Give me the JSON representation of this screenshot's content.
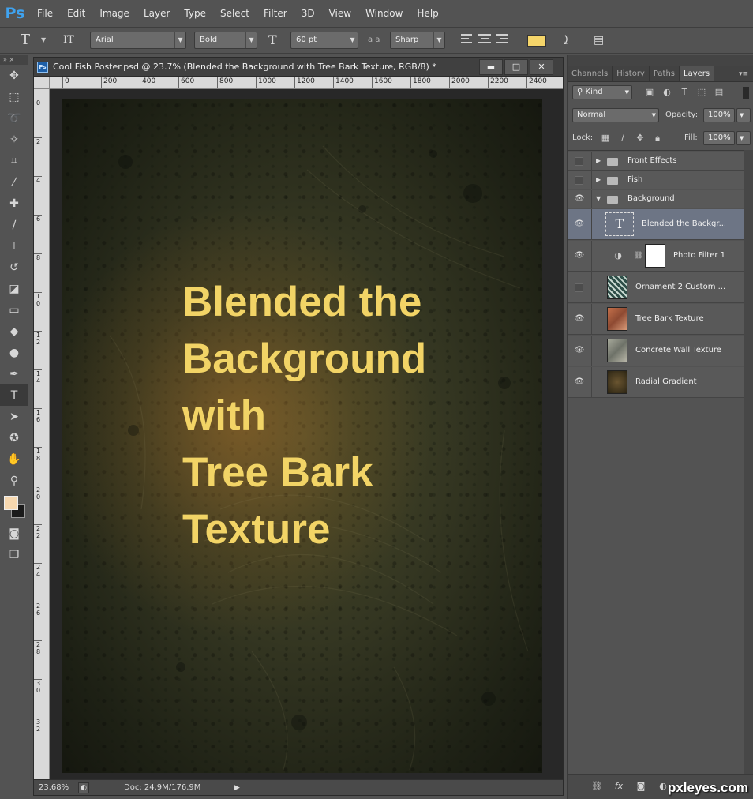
{
  "app": {
    "logo": "Ps"
  },
  "menu": [
    "File",
    "Edit",
    "Image",
    "Layer",
    "Type",
    "Select",
    "Filter",
    "3D",
    "View",
    "Window",
    "Help"
  ],
  "options": {
    "tool_icon": "T",
    "orient_icon": "IT",
    "font_family": "Arial",
    "font_style": "Bold",
    "size_icon": "T",
    "font_size": "60 pt",
    "aa_icon": "a a",
    "antialias": "Sharp",
    "text_color": "#f5d56a"
  },
  "document": {
    "title": "Cool Fish Poster.psd @ 23.7% (Blended the Background with  Tree Bark Texture, RGB/8) *",
    "ps_icon": "Ps",
    "ruler_h": [
      "0",
      "200",
      "400",
      "600",
      "800",
      "1000",
      "1200",
      "1400",
      "1600",
      "1800",
      "2000",
      "2200",
      "2400"
    ],
    "ruler_v": [
      "0",
      "2",
      "4",
      "6",
      "8",
      "1 0",
      "1 2",
      "1 4",
      "1 6",
      "1 8",
      "2 0",
      "2 2",
      "2 4",
      "2 6",
      "2 8",
      "3 0",
      "3 2"
    ],
    "poster_lines": [
      "Blended the",
      "Background",
      "with",
      "Tree Bark",
      "Texture"
    ],
    "zoom": "23.68%",
    "doc_size": "Doc: 24.9M/176.9M"
  },
  "panels": {
    "tabs": [
      "Channels",
      "History",
      "Paths",
      "Layers"
    ],
    "active_tab": "Layers",
    "kind": "Kind",
    "blend_mode": "Normal",
    "opacity_label": "Opacity:",
    "opacity": "100%",
    "lock_label": "Lock:",
    "fill_label": "Fill:",
    "fill": "100%"
  },
  "layers": [
    {
      "name": "Front Effects",
      "type": "group",
      "visible": false
    },
    {
      "name": "Fish",
      "type": "group",
      "visible": false
    },
    {
      "name": "Background",
      "type": "group-open",
      "visible": true
    },
    {
      "name": "Blended the Backgr...",
      "type": "text",
      "visible": true,
      "selected": true
    },
    {
      "name": "Photo Filter 1",
      "type": "adjustment",
      "visible": true
    },
    {
      "name": "Ornament 2 Custom ...",
      "type": "image",
      "visible": false
    },
    {
      "name": "Tree Bark Texture",
      "type": "image",
      "visible": true
    },
    {
      "name": "Concrete Wall Texture",
      "type": "image",
      "visible": true
    },
    {
      "name": "Radial Gradient",
      "type": "image",
      "visible": true
    }
  ],
  "watermark": "pxleyes.com",
  "icons": {
    "eye": "eye-icon",
    "folder": "folder-icon",
    "link": "link-icon"
  }
}
